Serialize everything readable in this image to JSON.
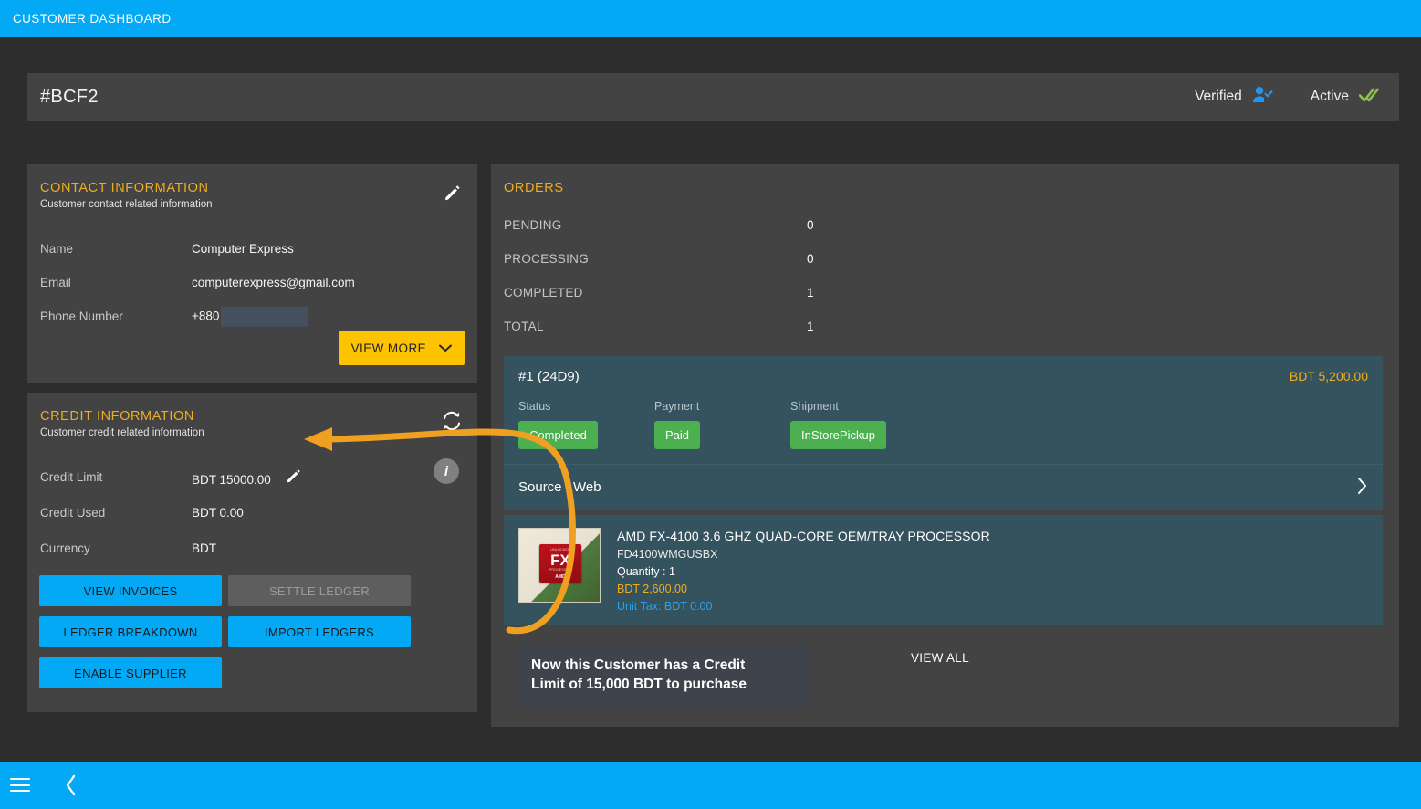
{
  "topbar": {
    "title": "CUSTOMER DASHBOARD",
    "bg": "#03a9f4"
  },
  "header": {
    "customer_id": "#BCF2",
    "badges": [
      {
        "label": "Verified",
        "icon": "user-check-icon",
        "color": "#2196f3"
      },
      {
        "label": "Active",
        "icon": "double-check-icon",
        "color": "#8bc34a"
      }
    ]
  },
  "contact": {
    "title": "CONTACT INFORMATION",
    "subtitle": "Customer contact related information",
    "edit_icon": "pencil-icon",
    "rows": [
      {
        "key": "Name",
        "value": "Computer Express"
      },
      {
        "key": "Email",
        "value": "computerexpress@gmail.com"
      },
      {
        "key": "Phone Number",
        "value": "+880",
        "redacted": true
      }
    ],
    "view_more_label": "VIEW MORE",
    "view_more_icon": "chevron-down-icon"
  },
  "credit": {
    "title": "CREDIT INFORMATION",
    "subtitle": "Customer credit related information",
    "refresh_icon": "sync-icon",
    "info_icon": "info-icon",
    "info_glyph": "i",
    "rows": [
      {
        "key": "Credit Limit",
        "value": "BDT 15000.00",
        "has_edit": true
      },
      {
        "key": "Credit Used",
        "value": "BDT 0.00",
        "has_edit": false
      },
      {
        "key": "Currency",
        "value": "BDT",
        "has_edit": false
      }
    ],
    "buttons": [
      {
        "label": "VIEW INVOICES",
        "disabled": false
      },
      {
        "label": "SETTLE LEDGER",
        "disabled": true
      },
      {
        "label": "LEDGER BREAKDOWN",
        "disabled": false
      },
      {
        "label": "IMPORT LEDGERS",
        "disabled": false
      },
      {
        "label": "ENABLE SUPPLIER",
        "disabled": false
      }
    ]
  },
  "orders": {
    "title": "ORDERS",
    "stats": [
      {
        "key": "PENDING",
        "value": "0"
      },
      {
        "key": "PROCESSING",
        "value": "0"
      },
      {
        "key": "COMPLETED",
        "value": "1"
      },
      {
        "key": "TOTAL",
        "value": "1"
      }
    ],
    "order": {
      "number": "#1 (24D9)",
      "amount": "BDT 5,200.00",
      "columns": [
        {
          "label": "Status",
          "chip": "Completed"
        },
        {
          "label": "Payment",
          "chip": "Paid"
        },
        {
          "label": "Shipment",
          "chip": "InStorePickup"
        }
      ],
      "source": "Source : Web",
      "expand_icon": "chevron-right-icon",
      "product": {
        "name": "AMD FX-4100 3.6 GHZ QUAD-CORE OEM/TRAY PROCESSOR",
        "sku": "FD4100WMGUSBX",
        "quantity": "Quantity : 1",
        "price": "BDT 2,600.00",
        "unit_tax": "Unit Tax: BDT 0.00",
        "image_icon": "amd-fx-processor-image",
        "image_text": "FX",
        "image_brand": "AMD",
        "image_top_text": "UNLOCKED",
        "image_sub_text": "PROCESSOR"
      }
    },
    "view_all_label": "VIEW ALL"
  },
  "annotation": {
    "line1": "Now this Customer has a Credit",
    "line2": "Limit of 15,000 BDT to purchase",
    "arrow_color": "#f0a020",
    "box_bg": "#3f434c"
  },
  "bottombar": {
    "menu_icon": "hamburger-menu-icon",
    "back_icon": "chevron-left-icon"
  }
}
